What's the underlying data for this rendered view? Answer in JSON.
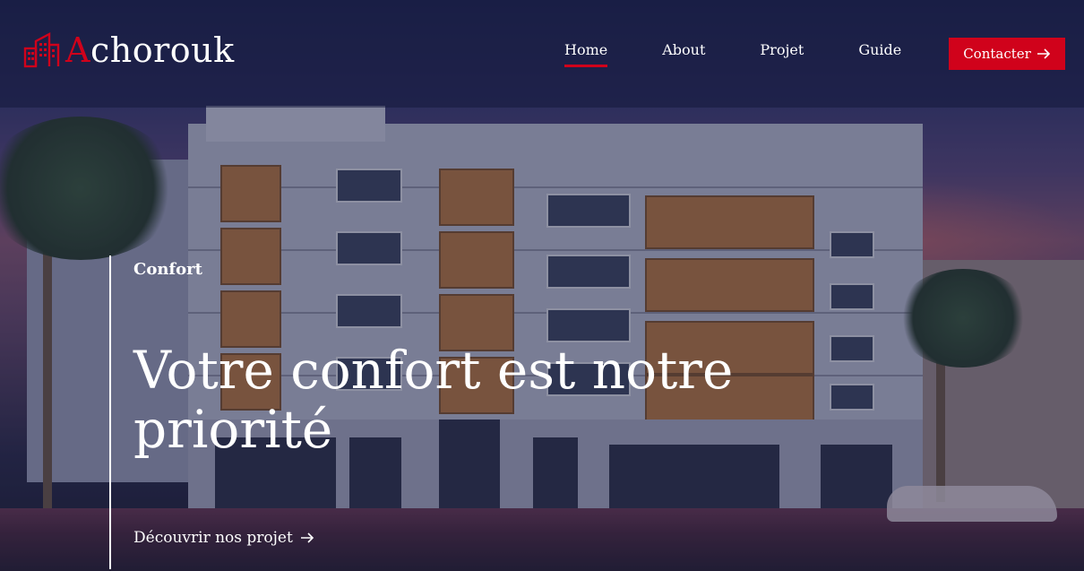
{
  "brand": {
    "first_letter": "A",
    "rest": "chorouk",
    "accent": "#d0021b"
  },
  "nav": {
    "items": [
      {
        "label": "Home",
        "active": true
      },
      {
        "label": "About"
      },
      {
        "label": "Projet"
      },
      {
        "label": "Guide"
      }
    ],
    "contact_label": "Contacter",
    "contact_icon": "arrow-right-icon"
  },
  "hero": {
    "eyebrow": "Confort",
    "headline": "Votre confort est notre priorité",
    "cta_label": "Découvrir nos projet",
    "cta_icon": "arrow-right-icon",
    "background": "night-street-apartment-building-photo"
  }
}
